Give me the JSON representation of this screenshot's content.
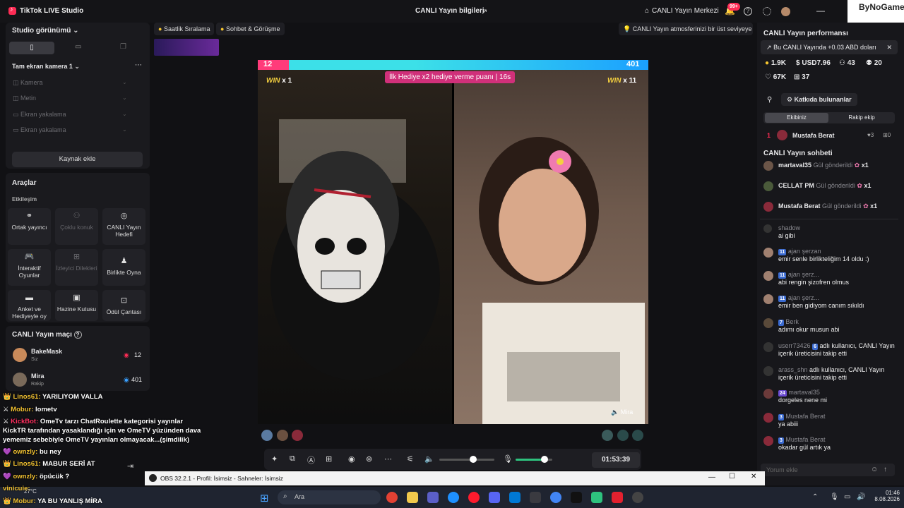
{
  "app": {
    "title": "TikTok LIVE Studio"
  },
  "header": {
    "center_title": "CANLI Yayın bilgileri",
    "hub": "CANLI Yayın Merkezi",
    "notif_count": "99+",
    "brand_watermark": "ByNoGame"
  },
  "left": {
    "studio_view": "Studio görünümü",
    "camera_header": "Tam ekran kamera 1",
    "sources": [
      "Kamera",
      "Metin",
      "Ekran yakalama",
      "Ekran yakalama"
    ],
    "add_source": "Kaynak ekle",
    "tools_title": "Araçlar",
    "interaction": "Etkileşim",
    "tools": [
      {
        "label": "Ortak yayıncı",
        "icon": "link-icon",
        "dim": false
      },
      {
        "label": "Çoklu konuk",
        "icon": "people-icon",
        "dim": true
      },
      {
        "label": "CANLI Yayın Hedefi",
        "icon": "target-icon",
        "dim": false
      },
      {
        "label": "İnteraktif Oyunlar",
        "icon": "gamepad-icon",
        "dim": false
      },
      {
        "label": "İzleyici Dilekleri",
        "icon": "gift-icon",
        "dim": true
      },
      {
        "label": "Birlikte Oyna",
        "icon": "joystick-icon",
        "dim": false
      },
      {
        "label": "Anket ve Hediyeyle oy",
        "icon": "poll-icon",
        "dim": false
      },
      {
        "label": "Hazine Kutusu",
        "icon": "chest-icon",
        "dim": false
      },
      {
        "label": "Ödül Çantası",
        "icon": "bag-icon",
        "dim": false
      }
    ],
    "match_title": "CANLI Yayın maçı",
    "match": [
      {
        "name": "BakeMask",
        "role": "Siz",
        "score": "12"
      },
      {
        "name": "Mira",
        "role": "Rakip",
        "score": "401"
      }
    ]
  },
  "overlay_chat": [
    {
      "user": "Linos61:",
      "text": "YARILIYOM VALLA",
      "color": "#f0c030"
    },
    {
      "user": "Mobur:",
      "text": "lometv",
      "color": "#f0c030"
    },
    {
      "user": "KickBot:",
      "text": "OmeTv tarzı ChatRoulette kategorisi yayınlar",
      "color": "#ff3060"
    },
    {
      "user": "",
      "text": "KickTR tarafından yasaklandığı için ve OmeTV yüzünden dava",
      "color": "#fff"
    },
    {
      "user": "",
      "text": "yememiz sebebiyle OmeTV yayınları olmayacak...(şimdilik)",
      "color": "#fff"
    },
    {
      "user": "ownzly:",
      "text": "bu ney",
      "color": "#f0c030"
    },
    {
      "user": "Linos61:",
      "text": "MABUR SERİ AT",
      "color": "#f0c030"
    },
    {
      "user": "ownzly:",
      "text": "öpücük ?",
      "color": "#f0c030"
    },
    {
      "user": "vinicuie:",
      "text": "",
      "color": "#f0c030"
    },
    {
      "user": "Mobur:",
      "text": "YA BU YANLIŞ MİRA",
      "color": "#f0c030"
    }
  ],
  "center": {
    "tags": [
      "Saatlik Sıralama",
      "Sohbet & Görüşme"
    ],
    "tip": "CANLI Yayın atmosferinizi bir üst seviyeye ...",
    "score_left": "12",
    "score_right": "401",
    "gift_banner": "İlk Hediye x2 hediye verme puanı",
    "countdown": "16s",
    "win_left": "x 1",
    "win_right": "x 11",
    "win_label": "WIN",
    "opponent_name": "Mira",
    "timer": "01:53:39",
    "volume_level": 0.62,
    "mic_level": 0.78
  },
  "right": {
    "perf_title": "CANLI Yayın performansı",
    "perf_note": "Bu CANLI Yayında +0.03 ABD doları",
    "stats": {
      "coins": "1.9K",
      "usd": "USD7.96",
      "viewers": "43",
      "comments": "20",
      "likes": "67K",
      "gifts": "37"
    },
    "contributors": "Katkıda bulunanlar",
    "tab_ours": "Ekibiniz",
    "tab_rival": "Rakip ekip",
    "top_rank": "1",
    "top_name": "Mustafa Berat",
    "top_likes": "3",
    "top_gifts": "0",
    "chat_title": "CANLI Yayın sohbeti",
    "gifts": [
      {
        "name": "martaval35",
        "text": "Gül gönderildi",
        "count": "x1"
      },
      {
        "name": "CELLAT PM",
        "text": "Gül gönderildi",
        "count": "x1"
      },
      {
        "name": "Mustafa Berat",
        "text": "Gül gönderildi",
        "count": "x1"
      }
    ],
    "chat": [
      {
        "user": "shadow",
        "level": "",
        "msg": "ai gibi"
      },
      {
        "user": "ajan şerzan",
        "level": "11",
        "msg": "emir senle birlikteliğim 14 oldu :)"
      },
      {
        "user": "ajan şerz...",
        "level": "11",
        "msg": "abi rengin şizofren olmus"
      },
      {
        "user": "ajan şerz...",
        "level": "11",
        "msg": "emir ben gidiyom canım sıkıldı"
      },
      {
        "user": "Berk",
        "level": "7",
        "msg": "adımı okur musun abi"
      },
      {
        "user": "userr73426",
        "level": "6",
        "msg": "adlı kullanıcı, CANLI Yayın içerik üreticisini takip etti"
      },
      {
        "user": "arass_shn",
        "level": "",
        "msg": "adlı kullanıcı, CANLI Yayın içerik üreticisini takip etti"
      },
      {
        "user": "martaval35",
        "level": "24",
        "msg": "dorgeles nene mi"
      },
      {
        "user": "Mustafa Berat",
        "level": "3",
        "msg": "ya abiii"
      },
      {
        "user": "Mustafa Berat",
        "level": "3",
        "msg": "okadar gül artık ya"
      }
    ],
    "chat_placeholder": "Yorum ekle"
  },
  "obs": {
    "title": "OBS 32.2.1 - Profil: İsimsiz - Sahneler: İsimsiz"
  },
  "taskbar": {
    "search": "Ara",
    "time": "01:46",
    "date": "8.08.2026",
    "weather": "27°C"
  }
}
